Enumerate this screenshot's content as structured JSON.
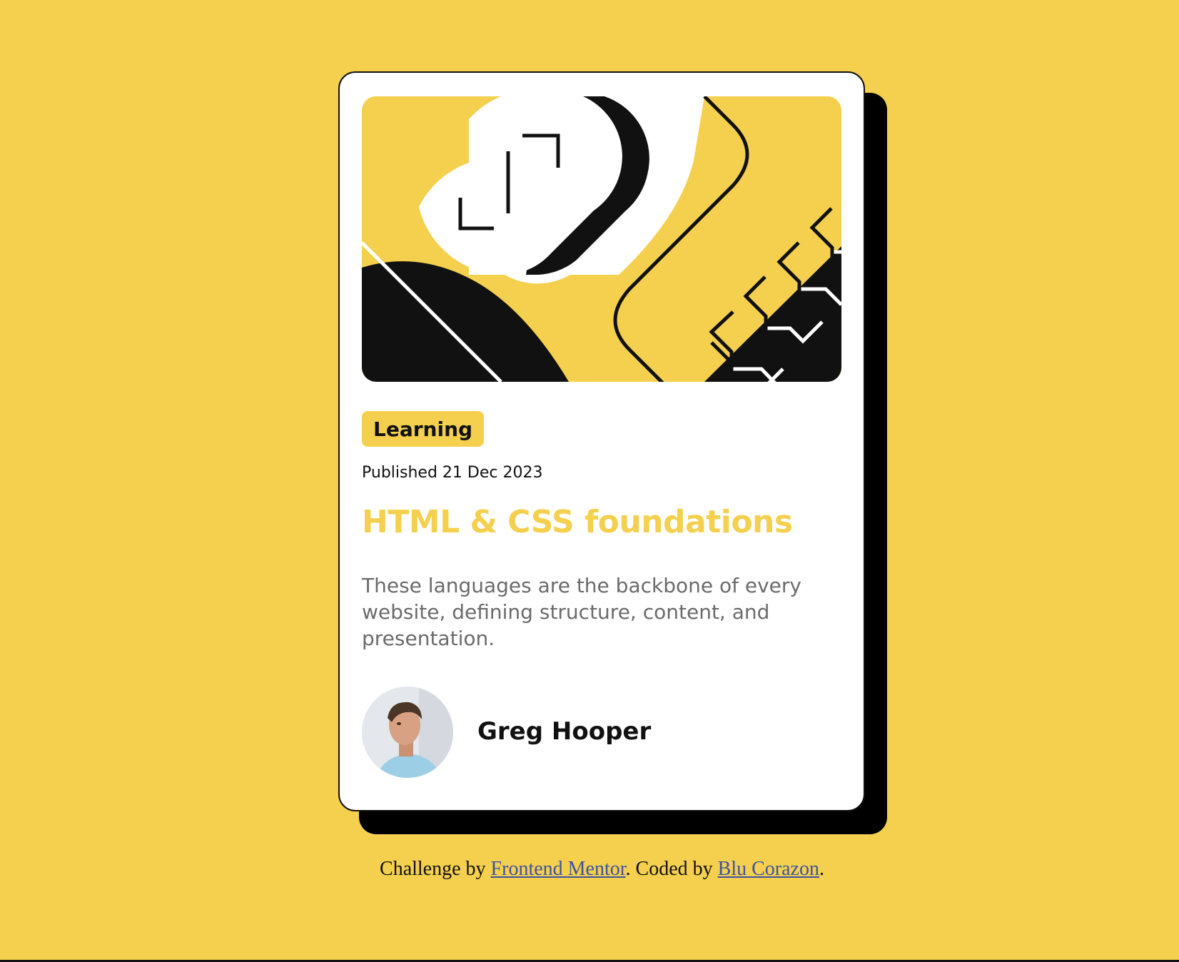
{
  "card": {
    "category": "Learning",
    "published": "Published 21 Dec 2023",
    "title": "HTML & CSS foundations",
    "description": "These languages are the backbone of every website, defining structure, content, and presentation.",
    "author": "Greg Hooper"
  },
  "footer": {
    "prefix": "Challenge by ",
    "link1": "Frontend Mentor",
    "middle": ". Coded by ",
    "link2": "Blu Corazon",
    "suffix": "."
  },
  "colors": {
    "background": "#F4D04E",
    "card": "#FFFFFF",
    "title": "#F4D04E",
    "text": "#111111",
    "muted": "#6B6B6B",
    "link": "#3E52A3"
  }
}
